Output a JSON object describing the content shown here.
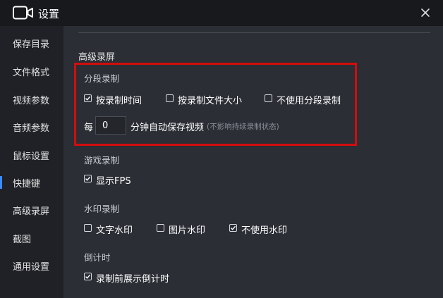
{
  "window": {
    "title": "设置",
    "close_icon": "close-icon",
    "app_icon": "video-camera-icon"
  },
  "sidebar": {
    "items": [
      {
        "label": "保存目录"
      },
      {
        "label": "文件格式"
      },
      {
        "label": "视频参数"
      },
      {
        "label": "音频参数"
      },
      {
        "label": "鼠标设置"
      },
      {
        "label": "快捷键"
      },
      {
        "label": "高级录屏"
      },
      {
        "label": "截图"
      },
      {
        "label": "通用设置"
      }
    ],
    "active_index": 5,
    "accent_color": "#3d8bff"
  },
  "main": {
    "heading": "高级录屏",
    "segment": {
      "title": "分段录制",
      "options": [
        {
          "label": "按录制时间",
          "checked": true
        },
        {
          "label": "按录制文件大小",
          "checked": false
        },
        {
          "label": "不使用分段录制",
          "checked": false
        }
      ],
      "every_label": "每",
      "minutes_value": "0",
      "minutes_label": "分钟自动保存视频",
      "hint": "(不影响持续录制状态)",
      "highlight_color": "#d40c0c"
    },
    "game": {
      "title": "游戏录制",
      "options": [
        {
          "label": "显示FPS",
          "checked": true
        }
      ]
    },
    "watermark": {
      "title": "水印录制",
      "options": [
        {
          "label": "文字水印",
          "checked": false
        },
        {
          "label": "图片水印",
          "checked": false
        },
        {
          "label": "不使用水印",
          "checked": true
        }
      ]
    },
    "countdown": {
      "title": "倒计时",
      "options": [
        {
          "label": "录制前展示倒计时",
          "checked": true
        }
      ]
    }
  }
}
